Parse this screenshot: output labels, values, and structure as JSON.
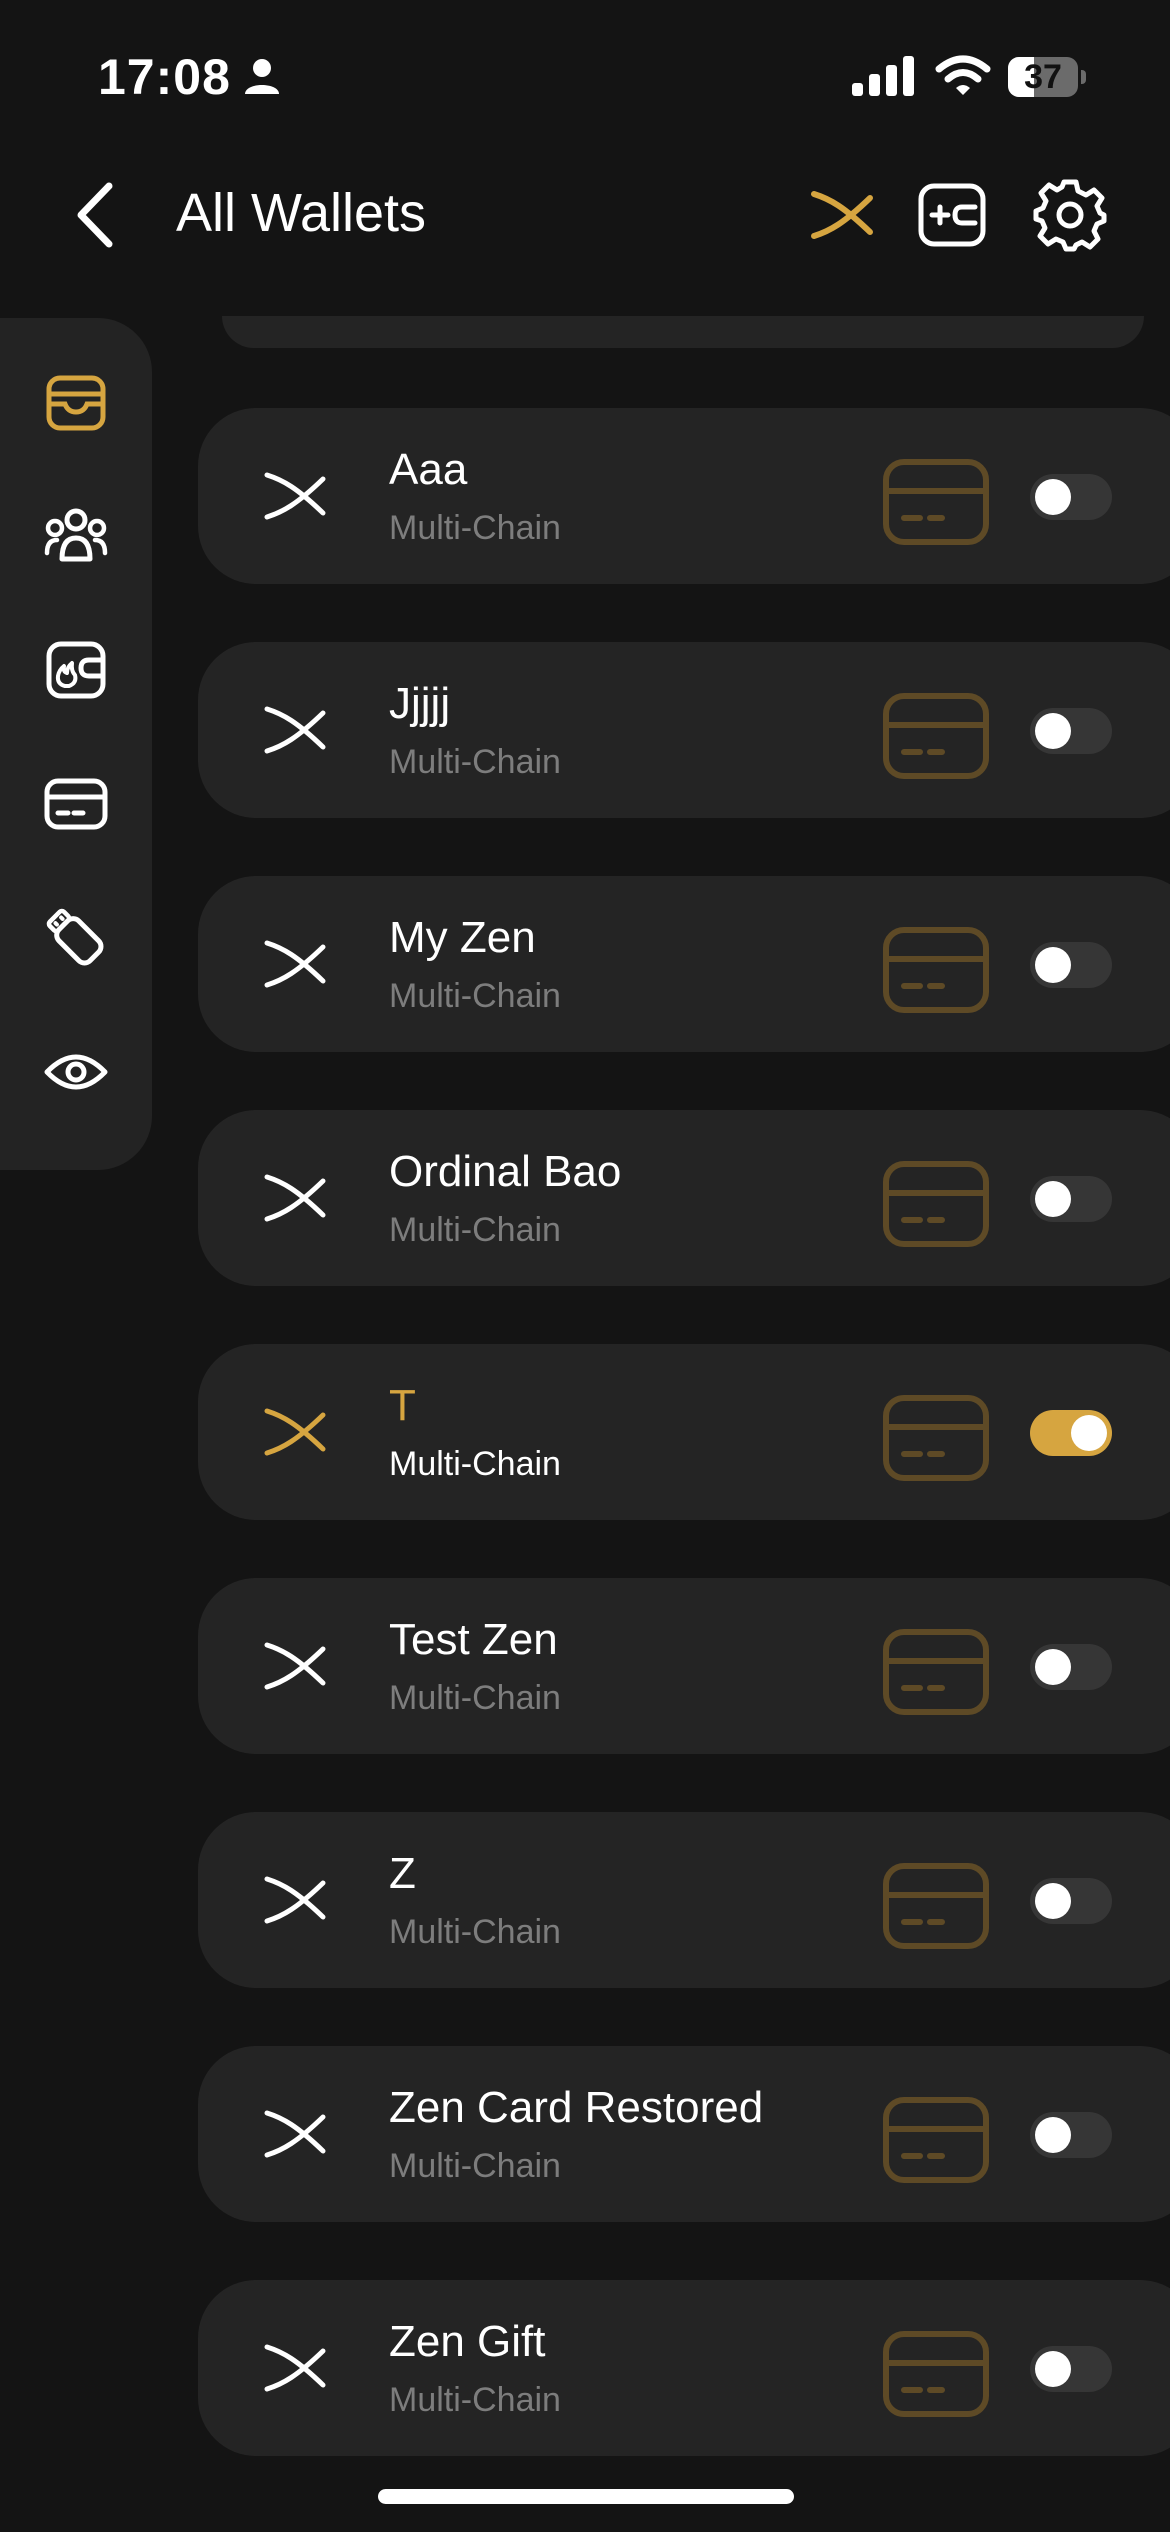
{
  "status_bar": {
    "time": "17:08",
    "battery_level": "37",
    "battery_fraction": 0.37,
    "icons": [
      "person-icon",
      "signal-icon",
      "wifi-icon",
      "battery-icon"
    ]
  },
  "header": {
    "title": "All Wallets",
    "icons": [
      "back-chevron-icon",
      "zen-logo-icon",
      "add-card-icon",
      "gear-icon"
    ]
  },
  "sidebar": {
    "items": [
      {
        "icon": "wallet-icon",
        "active": true
      },
      {
        "icon": "group-icon",
        "active": false
      },
      {
        "icon": "fire-wallet-icon",
        "active": false
      },
      {
        "icon": "card-icon",
        "active": false
      },
      {
        "icon": "usb-key-icon",
        "active": false
      },
      {
        "icon": "eye-icon",
        "active": false
      }
    ]
  },
  "wallets": [
    {
      "name": "Aaa",
      "subtitle": "Multi-Chain",
      "enabled": false
    },
    {
      "name": "Jjjjj",
      "subtitle": "Multi-Chain",
      "enabled": false
    },
    {
      "name": "My Zen",
      "subtitle": "Multi-Chain",
      "enabled": false
    },
    {
      "name": "Ordinal Bao",
      "subtitle": "Multi-Chain",
      "enabled": false
    },
    {
      "name": "T",
      "subtitle": "Multi-Chain",
      "enabled": true
    },
    {
      "name": "Test Zen",
      "subtitle": "Multi-Chain",
      "enabled": false
    },
    {
      "name": "Z",
      "subtitle": "Multi-Chain",
      "enabled": false
    },
    {
      "name": "Zen Card Restored",
      "subtitle": "Multi-Chain",
      "enabled": false
    },
    {
      "name": "Zen Gift",
      "subtitle": "Multi-Chain",
      "enabled": false
    }
  ],
  "colors": {
    "background": "#141414",
    "card": "#242424",
    "accent": "#d6a540",
    "muted_accent": "#5e4a26",
    "subtitle": "#7d7d7d"
  }
}
